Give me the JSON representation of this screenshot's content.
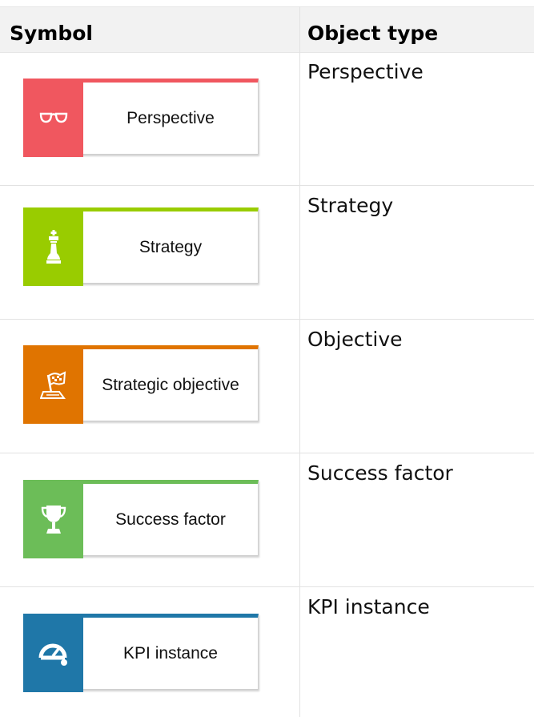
{
  "header": {
    "symbol": "Symbol",
    "object_type": "Object type"
  },
  "rows": [
    {
      "symbol_label": "Perspective",
      "object_type": "Perspective",
      "color": "#f0575f",
      "icon": "glasses-icon"
    },
    {
      "symbol_label": "Strategy",
      "object_type": "Strategy",
      "color": "#99cc00",
      "icon": "chess-piece-icon"
    },
    {
      "symbol_label": "Strategic objective",
      "object_type": "Objective",
      "color": "#e07400",
      "icon": "flag-icon"
    },
    {
      "symbol_label": "Success factor",
      "object_type": "Success factor",
      "color": "#6cbd58",
      "icon": "trophy-icon"
    },
    {
      "symbol_label": "KPI instance",
      "object_type": "KPI instance",
      "color": "#1f77a8",
      "icon": "gauge-icon"
    }
  ]
}
